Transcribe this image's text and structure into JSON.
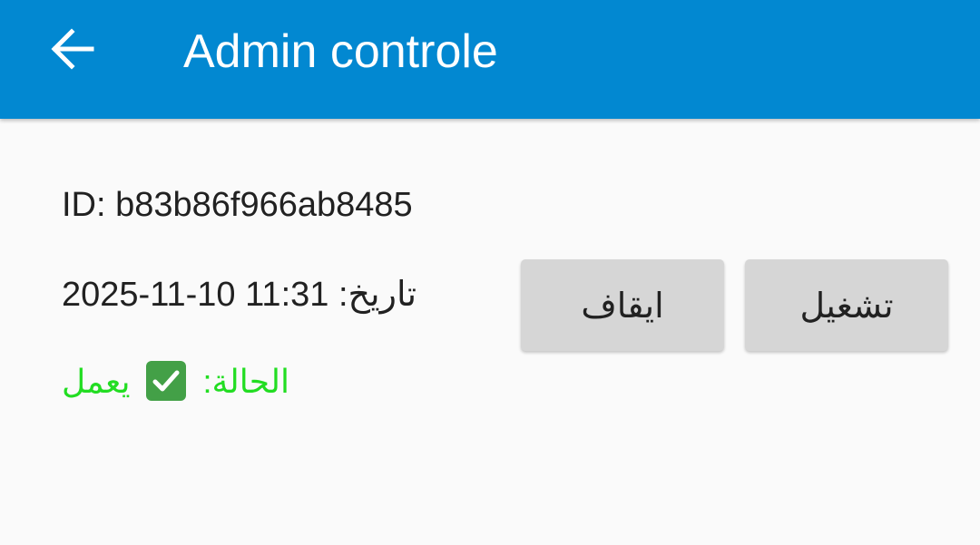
{
  "app_bar": {
    "title": "Admin controle",
    "back_icon": "arrow-left-icon",
    "color": "#0288d1"
  },
  "device": {
    "id_text": "ID: b83b86f966ab8485",
    "date_label": "تاريخ:",
    "date_value": "2025-11-10 11:31",
    "status_label": "الحالة:",
    "status_icon": "check-mark-button-icon",
    "status_value": "يعمل",
    "status_color": "#22dd22"
  },
  "actions": {
    "stop_label": "ايقاف",
    "start_label": "تشغيل"
  }
}
